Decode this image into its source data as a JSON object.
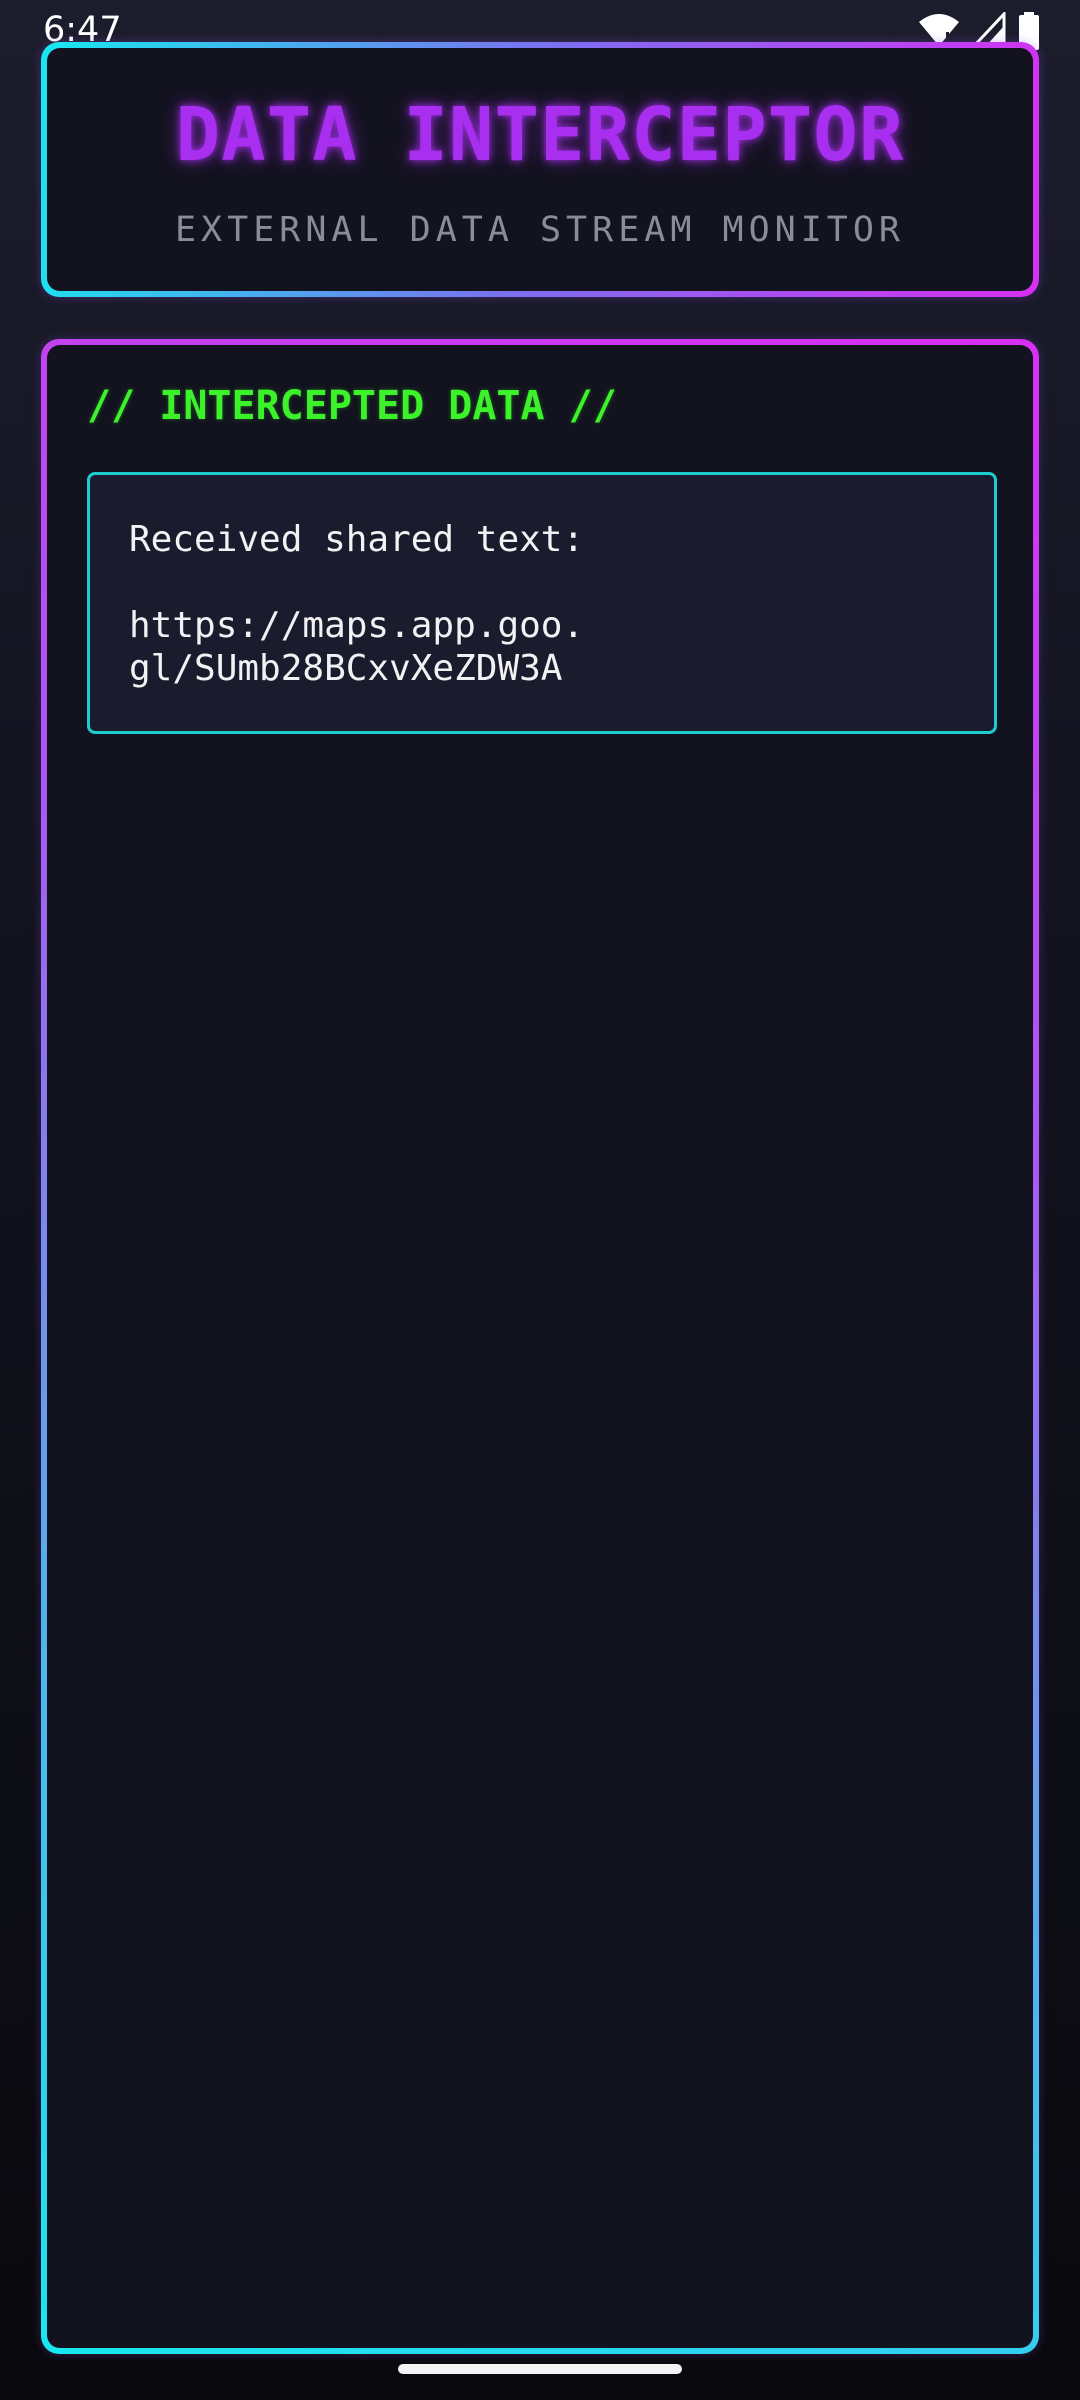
{
  "status_bar": {
    "time": "6:47",
    "icons": [
      "wifi-icon",
      "cell-signal-icon",
      "battery-icon"
    ]
  },
  "header": {
    "title": "DATA INTERCEPTOR",
    "subtitle": "EXTERNAL DATA STREAM MONITOR"
  },
  "content": {
    "heading": "// INTERCEPTED DATA //",
    "card": {
      "label": "Received shared text:",
      "value": "https://maps.app.goo.gl/SUmb28BCxvXeZDW3A"
    }
  },
  "colors": {
    "accent_purple": "#a82ff0",
    "accent_green": "#3cf22a",
    "accent_cyan": "#1ccdd0",
    "accent_magenta": "#d72ff2",
    "background": "#13131f"
  }
}
